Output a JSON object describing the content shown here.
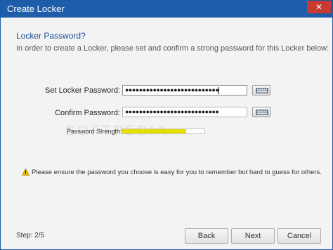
{
  "window": {
    "title": "Create Locker",
    "close_label": "✕"
  },
  "main": {
    "heading": "Locker Password?",
    "description": "In order to create a Locker, please set and confirm a strong password for this Locker below:",
    "set_password": {
      "label": "Set Locker Password:",
      "value": "●●●●●●●●●●●●●●●●●●●●●●●●●●●"
    },
    "confirm_password": {
      "label": "Confirm Password:",
      "value": "●●●●●●●●●●●●●●●●●●●●●●●●●●●"
    },
    "strength": {
      "label": "Password Strength:",
      "level": 0.78,
      "color": "#e5e000"
    },
    "watermark": "SOFTPEDIA",
    "warning": "Please ensure the password you choose is easy for you to remember but hard to guess for others."
  },
  "footer": {
    "step": "Step: 2/5",
    "back_label": "Back",
    "next_label": "Next",
    "cancel_label": "Cancel"
  },
  "colors": {
    "titlebar": "#1e5da9",
    "close": "#c8392f",
    "heading": "#1f4e96"
  },
  "icons": [
    "keyboard-icon",
    "warning-icon",
    "close-icon"
  ]
}
